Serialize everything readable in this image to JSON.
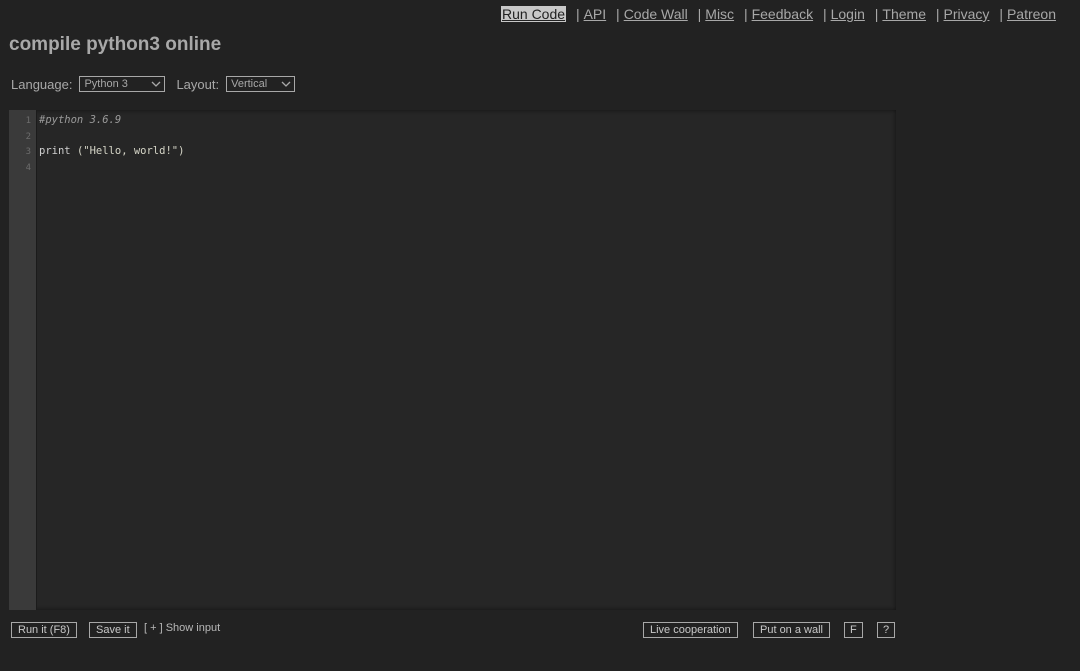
{
  "nav": {
    "items": [
      {
        "label": "Run Code",
        "active": true
      },
      {
        "label": "API"
      },
      {
        "label": "Code Wall"
      },
      {
        "label": "Misc"
      },
      {
        "label": "Feedback"
      },
      {
        "label": "Login"
      },
      {
        "label": "Theme"
      },
      {
        "label": "Privacy"
      },
      {
        "label": "Patreon"
      }
    ],
    "separator": "|"
  },
  "title": "compile python3 online",
  "options": {
    "language_label": "Language:",
    "language_value": "Python 3",
    "layout_label": "Layout:",
    "layout_value": "Vertical"
  },
  "editor": {
    "line_numbers": [
      "1",
      "2",
      "3",
      "4"
    ],
    "lines": [
      {
        "comment": "#python 3.6.9"
      },
      {},
      {
        "kw": "print ",
        "str": "(\"Hello, world!\")"
      },
      {}
    ]
  },
  "bottom": {
    "run_label": "Run it (F8)",
    "save_label": "Save it",
    "show_input_label": "[ + ] Show input",
    "live_label": "Live cooperation",
    "wall_label": "Put on a wall",
    "f_label": "F",
    "help_label": "?"
  },
  "colors": {
    "background": "#222222",
    "text": "#a8a8a8",
    "gutter": "#3a3a3a"
  }
}
